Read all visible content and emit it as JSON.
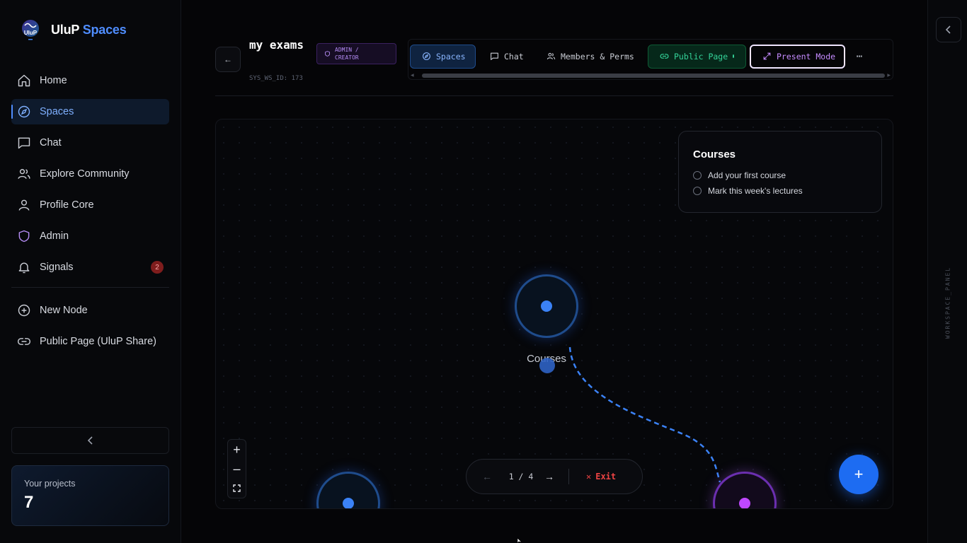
{
  "brand": {
    "name": "UluP",
    "accent": "Spaces",
    "logo_text": "UluP"
  },
  "sidebar": {
    "items": [
      {
        "label": "Home",
        "icon": "home-icon"
      },
      {
        "label": "Spaces",
        "icon": "compass-icon",
        "active": true
      },
      {
        "label": "Chat",
        "icon": "chat-icon"
      },
      {
        "label": "Explore Community",
        "icon": "users-icon"
      },
      {
        "label": "Profile Core",
        "icon": "user-icon"
      },
      {
        "label": "Admin",
        "icon": "shield-icon"
      },
      {
        "label": "Signals",
        "icon": "bell-icon",
        "badge": "2"
      }
    ],
    "secondary": [
      {
        "label": "New Node",
        "icon": "plus-circle-icon"
      },
      {
        "label": "Public Page (UluP Share)",
        "icon": "link-icon"
      }
    ],
    "projects": {
      "label": "Your projects",
      "count": "7"
    }
  },
  "header": {
    "title": "my exams",
    "sys_id": "SYS_WS_ID: 173",
    "role_badge": "ADMIN / CREATOR",
    "tabs": {
      "spaces": "Spaces",
      "chat": "Chat",
      "members": "Members & Perms",
      "public": "Public Page",
      "present": "Present Mode"
    }
  },
  "canvas": {
    "card": {
      "title": "Courses",
      "items": [
        "Add your first course",
        "Mark this week's lectures"
      ]
    },
    "node_label": "Courses",
    "pager": {
      "count": "1 / 4",
      "exit": "Exit"
    }
  },
  "right_panel": {
    "label": "WORKSPACE_PANEL"
  },
  "colors": {
    "accent": "#4f8dff",
    "public_green": "#34d399",
    "present_purple": "#c58bff",
    "node_blue": "#3b82f6",
    "node_purple": "#c048ff",
    "exit_red": "#ef4444"
  }
}
